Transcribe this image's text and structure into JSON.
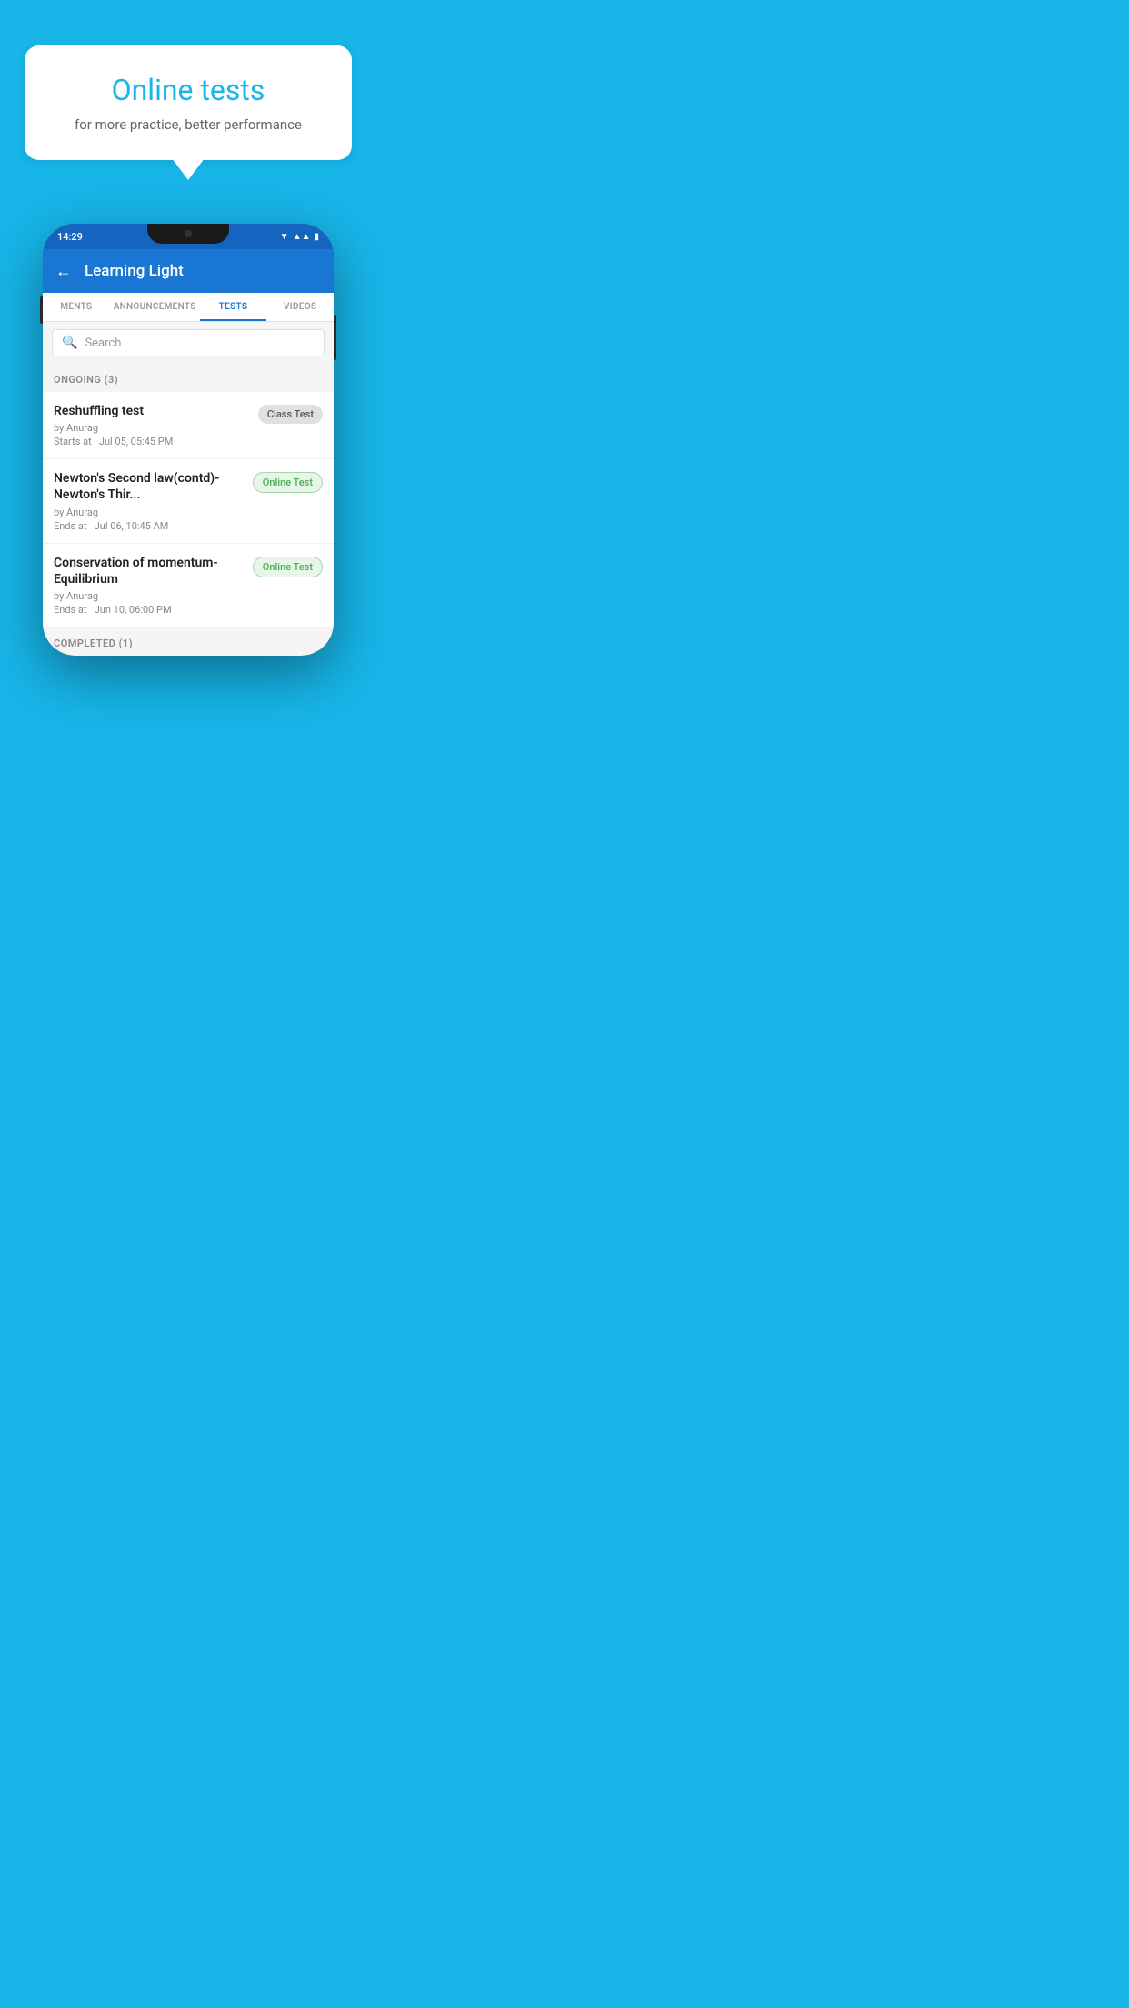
{
  "hero": {
    "bubble_title": "Online tests",
    "bubble_subtitle": "for more practice, better performance"
  },
  "status_bar": {
    "time": "14:29"
  },
  "app_header": {
    "title": "Learning Light"
  },
  "tabs": [
    {
      "label": "MENTS",
      "active": false
    },
    {
      "label": "ANNOUNCEMENTS",
      "active": false
    },
    {
      "label": "TESTS",
      "active": true
    },
    {
      "label": "VIDEOS",
      "active": false
    }
  ],
  "search": {
    "placeholder": "Search"
  },
  "ongoing_section": {
    "label": "ONGOING (3)"
  },
  "tests": [
    {
      "name": "Reshuffling test",
      "author": "by Anurag",
      "time_label": "Starts at",
      "time": "Jul 05, 05:45 PM",
      "badge": "Class Test",
      "badge_type": "class"
    },
    {
      "name": "Newton's Second law(contd)-Newton's Thir...",
      "author": "by Anurag",
      "time_label": "Ends at",
      "time": "Jul 06, 10:45 AM",
      "badge": "Online Test",
      "badge_type": "online"
    },
    {
      "name": "Conservation of momentum-Equilibrium",
      "author": "by Anurag",
      "time_label": "Ends at",
      "time": "Jun 10, 06:00 PM",
      "badge": "Online Test",
      "badge_type": "online"
    }
  ],
  "completed_section": {
    "label": "COMPLETED (1)"
  }
}
